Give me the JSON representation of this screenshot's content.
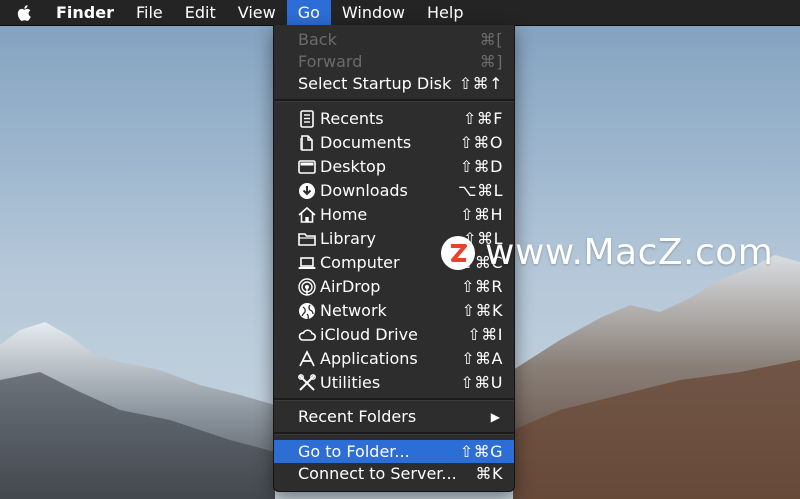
{
  "menubar": {
    "items": [
      {
        "label": "Finder"
      },
      {
        "label": "File"
      },
      {
        "label": "Edit"
      },
      {
        "label": "View"
      },
      {
        "label": "Go"
      },
      {
        "label": "Window"
      },
      {
        "label": "Help"
      }
    ],
    "active_item": "Go"
  },
  "go_menu": {
    "items": [
      {
        "label": "Back",
        "shortcut": "⌘[",
        "enabled": false
      },
      {
        "label": "Forward",
        "shortcut": "⌘]",
        "enabled": false
      },
      {
        "label": "Select Startup Disk",
        "shortcut": "⇧⌘↑",
        "enabled": true
      },
      {
        "label": "Recents",
        "shortcut": "⇧⌘F",
        "icon": "recents-icon"
      },
      {
        "label": "Documents",
        "shortcut": "⇧⌘O",
        "icon": "documents-icon"
      },
      {
        "label": "Desktop",
        "shortcut": "⇧⌘D",
        "icon": "desktop-icon"
      },
      {
        "label": "Downloads",
        "shortcut": "⌥⌘L",
        "icon": "downloads-icon"
      },
      {
        "label": "Home",
        "shortcut": "⇧⌘H",
        "icon": "home-icon"
      },
      {
        "label": "Library",
        "shortcut": "⇧⌘L",
        "icon": "library-folder-icon"
      },
      {
        "label": "Computer",
        "shortcut": "⇧⌘C",
        "icon": "computer-icon"
      },
      {
        "label": "AirDrop",
        "shortcut": "⇧⌘R",
        "icon": "airdrop-icon"
      },
      {
        "label": "Network",
        "shortcut": "⇧⌘K",
        "icon": "network-icon"
      },
      {
        "label": "iCloud Drive",
        "shortcut": "⇧⌘I",
        "icon": "icloud-icon"
      },
      {
        "label": "Applications",
        "shortcut": "⇧⌘A",
        "icon": "applications-icon"
      },
      {
        "label": "Utilities",
        "shortcut": "⇧⌘U",
        "icon": "utilities-icon"
      },
      {
        "label": "Recent Folders",
        "submenu": true
      },
      {
        "label": "Go to Folder...",
        "shortcut": "⇧⌘G",
        "selected": true
      },
      {
        "label": "Connect to Server...",
        "shortcut": "⌘K"
      }
    ]
  },
  "watermark": {
    "text": "www.MacZ.com",
    "badge_letter": "Z"
  },
  "colors": {
    "highlight": "#2c6dd6",
    "menu_bg": "#2d2d2d",
    "menubar_bg": "#242424",
    "watermark_badge": "#e8412c"
  }
}
